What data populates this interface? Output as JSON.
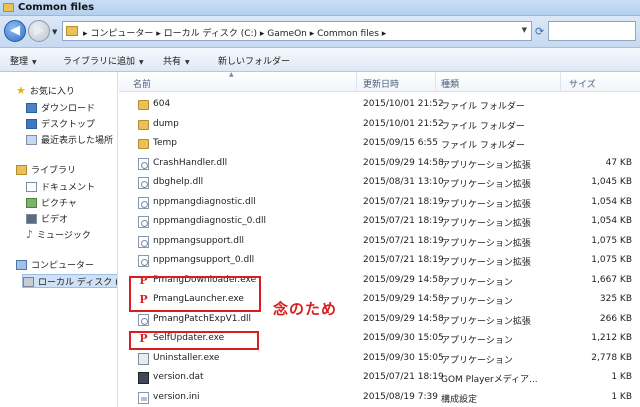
{
  "window": {
    "title": "Common files"
  },
  "address": {
    "crumbs": "▸ コンピューター ▸ ローカル ディスク (C:) ▸ GameOn ▸ Common files ▸",
    "back_glyph": "◀",
    "forward_glyph": "▶"
  },
  "toolbar": {
    "organize": "整理",
    "add_to_library": "ライブラリに追加",
    "share": "共有",
    "new_folder": "新しいフォルダー"
  },
  "nav": {
    "favorites": "お気に入り",
    "downloads": "ダウンロード",
    "desktop": "デスクトップ",
    "recent": "最近表示した場所",
    "libraries": "ライブラリ",
    "documents": "ドキュメント",
    "pictures": "ピクチャ",
    "videos": "ビデオ",
    "music": "ミュージック",
    "computer": "コンピューター",
    "local_disk": "ローカル ディスク ("
  },
  "columns": {
    "name": "名前",
    "modified": "更新日時",
    "type": "種類",
    "size": "サイズ"
  },
  "files": [
    {
      "name": "604",
      "date": "2015/10/01 21:52",
      "type": "ファイル フォルダー",
      "size": "",
      "icon": "folder-icon"
    },
    {
      "name": "dump",
      "date": "2015/10/01 21:52",
      "type": "ファイル フォルダー",
      "size": "",
      "icon": "folder-icon"
    },
    {
      "name": "Temp",
      "date": "2015/09/15 6:55",
      "type": "ファイル フォルダー",
      "size": "",
      "icon": "folder-icon"
    },
    {
      "name": "CrashHandler.dll",
      "date": "2015/09/29 14:58",
      "type": "アプリケーション拡張",
      "size": "47 KB",
      "icon": "dll-file-icon"
    },
    {
      "name": "dbghelp.dll",
      "date": "2015/08/31 13:10",
      "type": "アプリケーション拡張",
      "size": "1,045 KB",
      "icon": "dll-file-icon"
    },
    {
      "name": "nppmangdiagnostic.dll",
      "date": "2015/07/21 18:19",
      "type": "アプリケーション拡張",
      "size": "1,054 KB",
      "icon": "dll-file-icon"
    },
    {
      "name": "nppmangdiagnostic_0.dll",
      "date": "2015/07/21 18:19",
      "type": "アプリケーション拡張",
      "size": "1,054 KB",
      "icon": "dll-file-icon"
    },
    {
      "name": "nppmangsupport.dll",
      "date": "2015/07/21 18:19",
      "type": "アプリケーション拡張",
      "size": "1,075 KB",
      "icon": "dll-file-icon"
    },
    {
      "name": "nppmangsupport_0.dll",
      "date": "2015/07/21 18:19",
      "type": "アプリケーション拡張",
      "size": "1,075 KB",
      "icon": "dll-file-icon"
    },
    {
      "name": "PmangDownloader.exe",
      "date": "2015/09/29 14:58",
      "type": "アプリケーション",
      "size": "1,667 KB",
      "icon": "pmang-exe-icon"
    },
    {
      "name": "PmangLauncher.exe",
      "date": "2015/09/29 14:58",
      "type": "アプリケーション",
      "size": "325 KB",
      "icon": "pmang-exe-icon"
    },
    {
      "name": "PmangPatchExpV1.dll",
      "date": "2015/09/29 14:58",
      "type": "アプリケーション拡張",
      "size": "266 KB",
      "icon": "dll-file-icon"
    },
    {
      "name": "SelfUpdater.exe",
      "date": "2015/09/30 15:05",
      "type": "アプリケーション",
      "size": "1,212 KB",
      "icon": "pmang-exe-icon"
    },
    {
      "name": "Uninstaller.exe",
      "date": "2015/09/30 15:05",
      "type": "アプリケーション",
      "size": "2,778 KB",
      "icon": "uninstaller-exe-icon"
    },
    {
      "name": "version.dat",
      "date": "2015/07/21 18:19",
      "type": "GOM Playerメディア...",
      "size": "1 KB",
      "icon": "dat-file-icon"
    },
    {
      "name": "version.ini",
      "date": "2015/08/19 7:39",
      "type": "構成設定",
      "size": "1 KB",
      "icon": "ini-file-icon"
    }
  ],
  "annotation": {
    "text": "念のため",
    "color": "#d81e1e"
  },
  "colors": {
    "accent": "#2d6fc4",
    "highlight": "#d81e1e",
    "selection": "#cfe1f6"
  }
}
